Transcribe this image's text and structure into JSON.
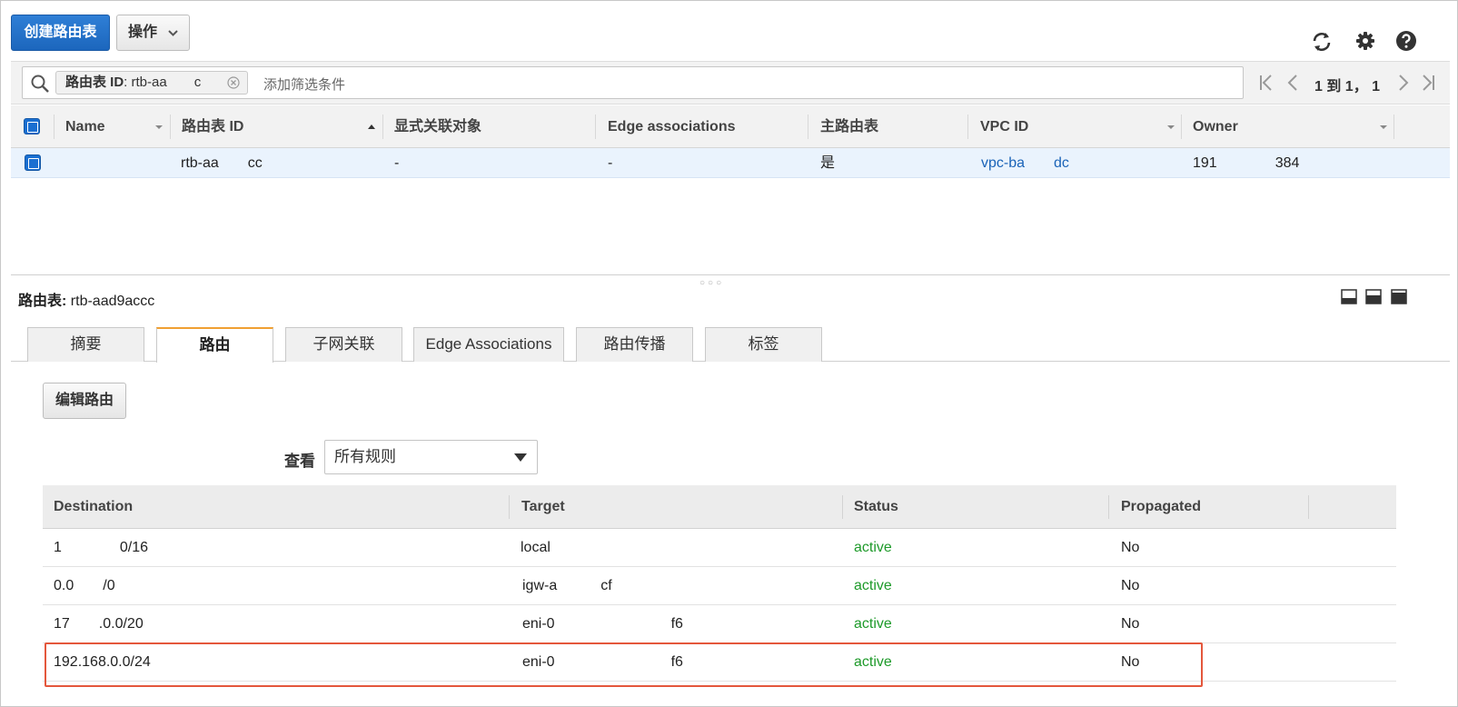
{
  "toolbar": {
    "create_label": "创建路由表",
    "actions_label": "操作",
    "icons": [
      "refresh-icon",
      "gear-icon",
      "help-icon"
    ]
  },
  "filter": {
    "token_key": "路由表 ID",
    "token_value": ": rtb-aa  c",
    "placeholder": "添加筛选条件",
    "pager_text": "1 到 1， 1"
  },
  "table": {
    "columns": [
      "Name",
      "路由表 ID",
      "显式关联对象",
      "Edge associations",
      "主路由表",
      "VPC ID",
      "Owner"
    ],
    "rows": [
      {
        "name": "",
        "route_table_id": "rtb-aa  cc",
        "explicit": "-",
        "edge": "-",
        "main": "是",
        "vpc_id": "vpc-ba  dc",
        "owner": "191    384"
      }
    ]
  },
  "detail": {
    "title_label": "路由表:",
    "title_value": "rtb-aad9accc",
    "tabs": [
      "摘要",
      "路由",
      "子网关联",
      "Edge Associations",
      "路由传播",
      "标签"
    ],
    "active_tab": 1,
    "edit_label": "编辑路由",
    "view_label": "查看",
    "view_value": "所有规则"
  },
  "routes": {
    "columns": [
      "Destination",
      "Target",
      "Status",
      "Propagated"
    ],
    "rows": [
      {
        "destination": "1    0/16",
        "target": "local",
        "status": "active",
        "propagated": "No"
      },
      {
        "destination": "0.0  /0",
        "target": "igw-a   cf",
        "status": "active",
        "propagated": "No"
      },
      {
        "destination": "17  .0.0/20",
        "target": "eni-0        f6",
        "status": "active",
        "propagated": "No"
      },
      {
        "destination": "192.168.0.0/24",
        "target": "eni-0        f6",
        "status": "active",
        "propagated": "No"
      }
    ]
  },
  "colors": {
    "primary": "#1c66bd",
    "link": "#1a63b8",
    "active": "#1e9a2a",
    "highlight": "#e4573c",
    "tab_accent": "#f0a032"
  }
}
